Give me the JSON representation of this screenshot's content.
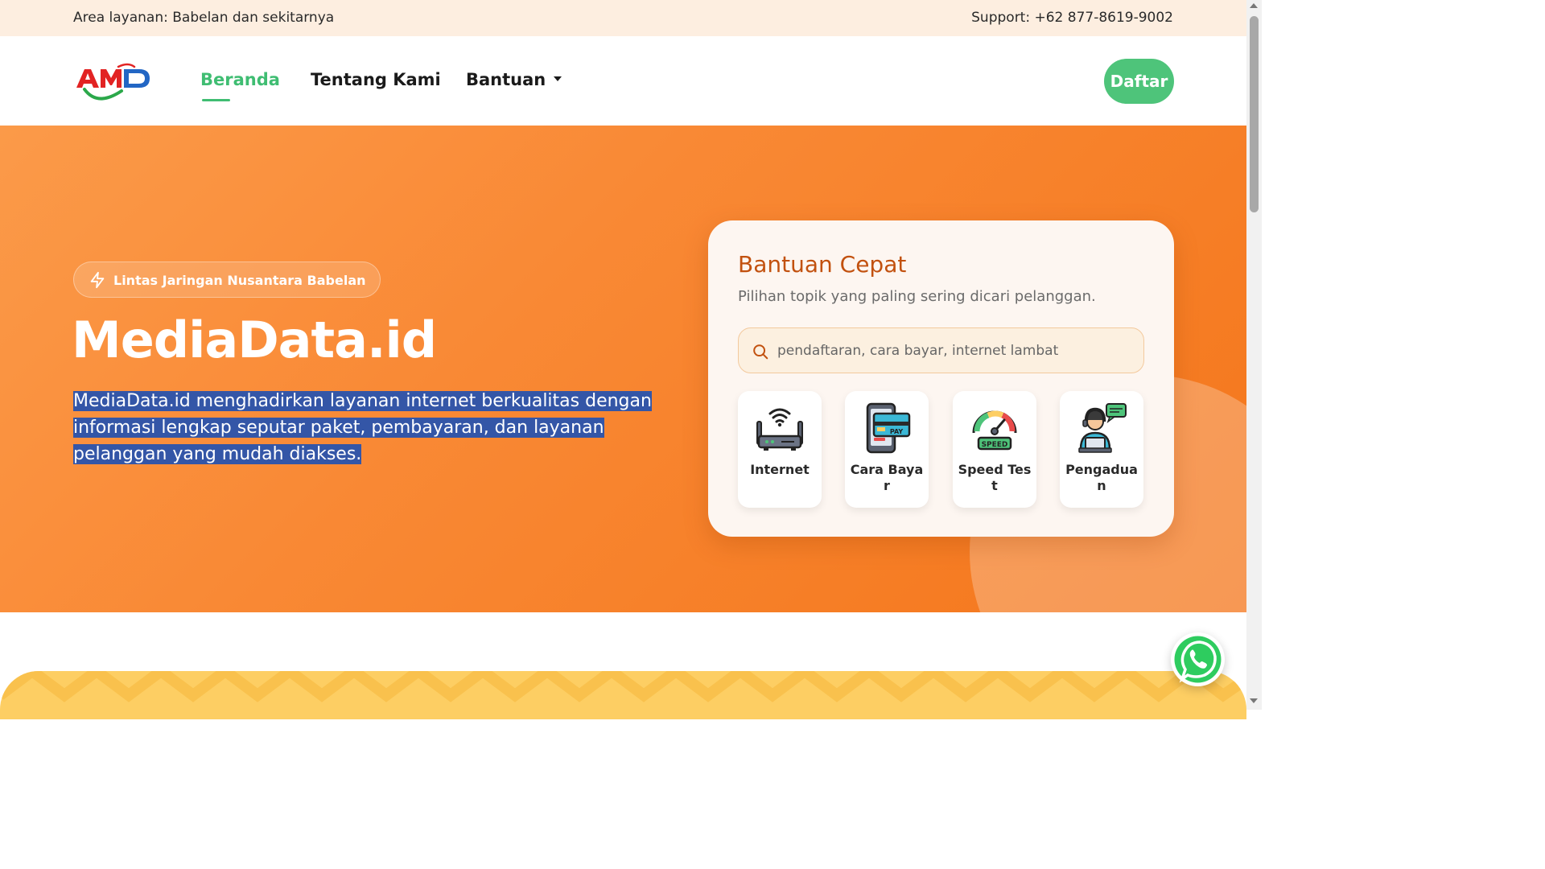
{
  "topbar": {
    "area": "Area layanan: Babelan dan sekitarnya",
    "support": "Support: +62 877-8619-9002"
  },
  "navbar": {
    "logo": "AMD",
    "items": [
      {
        "label": "Beranda",
        "active": true
      },
      {
        "label": "Tentang Kami",
        "active": false
      },
      {
        "label": "Bantuan",
        "active": false,
        "dropdown": true
      }
    ],
    "cta": "Daftar"
  },
  "hero": {
    "badge": "Lintas Jaringan Nusantara Babelan",
    "title": "MediaData.id",
    "description": "MediaData.id menghadirkan layanan internet berkualitas dengan informasi lengkap seputar paket, pembayaran, dan layanan pelanggan yang mudah diakses."
  },
  "help_card": {
    "title": "Bantuan Cepat",
    "subtitle": "Pilihan topik yang paling sering dicari pelanggan.",
    "search_placeholder": "pendaftaran, cara bayar, internet lambat",
    "tiles": [
      {
        "label": "Internet",
        "icon": "router-icon"
      },
      {
        "label": "Cara Bayar",
        "icon": "phone-pay-icon"
      },
      {
        "label": "Speed Test",
        "icon": "speedometer-icon"
      },
      {
        "label": "Pengaduan",
        "icon": "customer-support-icon"
      }
    ]
  },
  "speed_icon_text": "SPEED",
  "pay_icon_text": "PAY",
  "colors": {
    "accent_green": "#4ec47a",
    "hero_orange": "#f98935",
    "card_title": "#c2510f",
    "selection": "#3456a7"
  }
}
